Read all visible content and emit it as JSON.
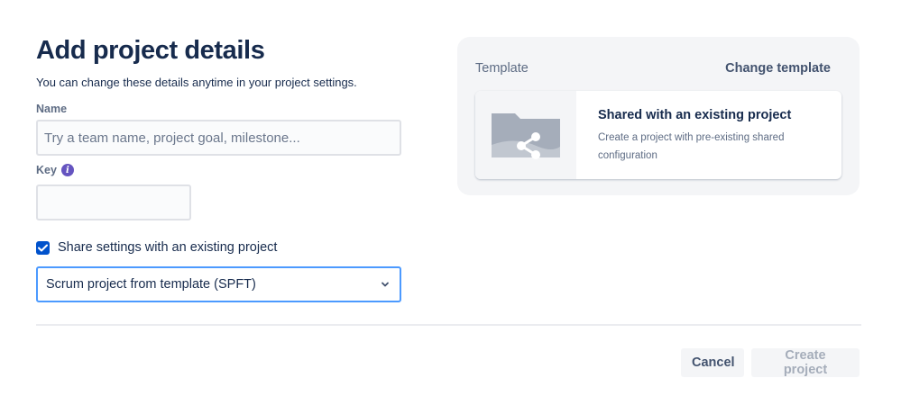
{
  "header": {
    "title": "Add project details",
    "subtitle": "You can change these details anytime in your project settings."
  },
  "form": {
    "name": {
      "label": "Name",
      "placeholder": "Try a team name, project goal, milestone...",
      "value": ""
    },
    "key": {
      "label": "Key",
      "value": "",
      "info_icon": "info-icon"
    },
    "share_settings": {
      "label": "Share settings with an existing project",
      "checked": true
    },
    "project_select": {
      "selected": "Scrum project from template (SPFT)",
      "icon": "chevron-down-icon"
    }
  },
  "template": {
    "label": "Template",
    "change_label": "Change template",
    "card": {
      "title": "Shared with an existing project",
      "description": "Create a project with pre-existing shared configuration",
      "icon": "shared-folder-icon"
    }
  },
  "footer": {
    "cancel_label": "Cancel",
    "create_label": "Create project"
  },
  "colors": {
    "primary_text": "#172b4d",
    "secondary_text": "#5e6c84",
    "accent": "#0052cc",
    "focus_border": "#4c9aff",
    "info_purple": "#6554c0",
    "panel_bg": "#f4f5f7",
    "disabled_text": "#a5adba"
  }
}
